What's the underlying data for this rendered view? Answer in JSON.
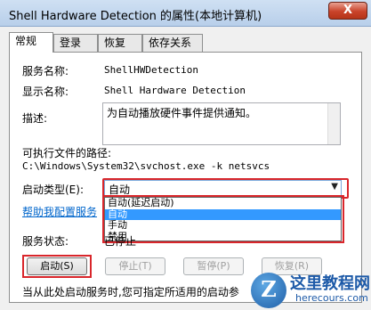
{
  "window": {
    "title": "Shell Hardware Detection 的属性(本地计算机)",
    "close_label": "X"
  },
  "tabs": [
    {
      "label": "常规"
    },
    {
      "label": "登录"
    },
    {
      "label": "恢复"
    },
    {
      "label": "依存关系"
    }
  ],
  "general": {
    "service_name_label": "服务名称:",
    "service_name_value": "ShellHWDetection",
    "display_name_label": "显示名称:",
    "display_name_value": "Shell Hardware Detection",
    "description_label": "描述:",
    "description_value": "为自动播放硬件事件提供通知。",
    "path_label": "可执行文件的路径:",
    "path_value": "C:\\Windows\\System32\\svchost.exe -k netsvcs",
    "startup_type_label": "启动类型(E):",
    "startup_type_value": "自动",
    "startup_options": [
      "自动(延迟启动)",
      "自动",
      "手动",
      "禁用"
    ],
    "startup_selected_index": 1,
    "help_link": "帮助我配置服务",
    "status_label": "服务状态:",
    "status_value": "已停止",
    "note": "当从此处启动服务时,您可指定所适用的启动参"
  },
  "buttons": {
    "start": "启动(S)",
    "stop": "停止(T)",
    "pause": "暂停(P)",
    "resume": "恢复(R)"
  },
  "watermark": {
    "logo_letter": "Z",
    "name": "这里教程网",
    "url": "herecours.com"
  },
  "colors": {
    "highlight_red": "#d9262b",
    "selection_blue": "#3399ff",
    "link_blue": "#0066cc"
  }
}
